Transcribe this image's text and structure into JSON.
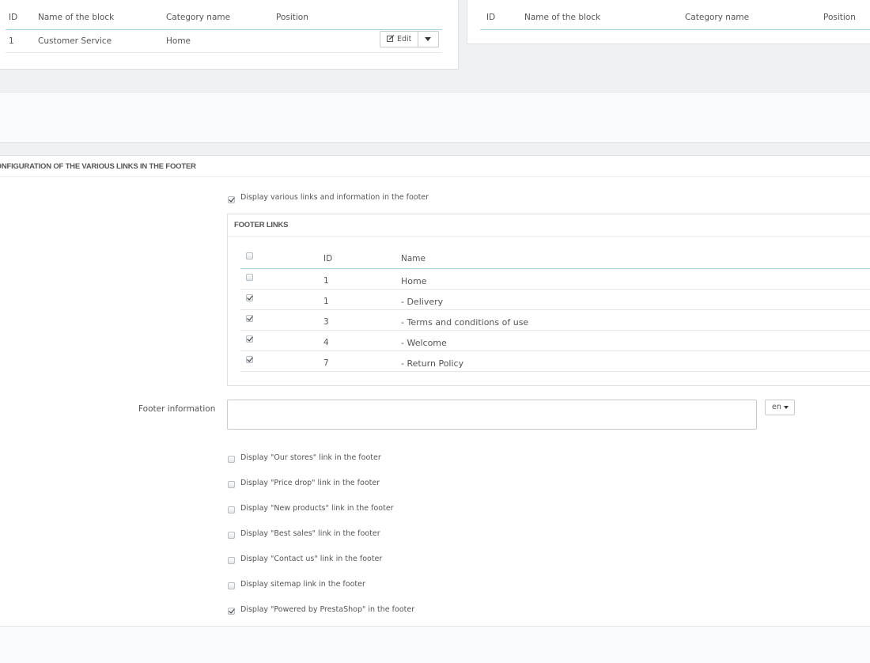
{
  "left_table": {
    "headers": [
      "ID",
      "Name of the block",
      "Category name",
      "Position"
    ],
    "rows": [
      {
        "id": "1",
        "name": "Customer Service",
        "category": "Home",
        "position": ""
      }
    ],
    "edit_label": "Edit"
  },
  "right_table": {
    "headers": [
      "ID",
      "Name of the block",
      "Category name",
      "Position"
    ]
  },
  "config": {
    "title": "CONFIGURATION OF THE VARIOUS LINKS IN THE FOOTER",
    "display_links_label": "Display various links and information in the footer",
    "display_links_checked": true,
    "footer_links": {
      "title": "FOOTER LINKS",
      "headers": {
        "id": "ID",
        "name": "Name"
      },
      "rows": [
        {
          "id": "1",
          "name": "Home",
          "checked": false
        },
        {
          "id": "1",
          "name": "- Delivery",
          "checked": true
        },
        {
          "id": "3",
          "name": "- Terms and conditions of use",
          "checked": true
        },
        {
          "id": "4",
          "name": "- Welcome",
          "checked": true
        },
        {
          "id": "7",
          "name": "- Return Policy",
          "checked": true
        }
      ]
    },
    "footer_information_label": "Footer information",
    "footer_information_value": "",
    "language": "en",
    "options": [
      {
        "label": "Display \"Our stores\" link in the footer",
        "checked": false
      },
      {
        "label": "Display \"Price drop\" link in the footer",
        "checked": false
      },
      {
        "label": "Display \"New products\" link in the footer",
        "checked": false
      },
      {
        "label": "Display \"Best sales\" link in the footer",
        "checked": false
      },
      {
        "label": "Display \"Contact us\" link in the footer",
        "checked": false
      },
      {
        "label": "Display sitemap link in the footer",
        "checked": false
      },
      {
        "label": "Display \"Powered by PrestaShop\" in the footer",
        "checked": true
      }
    ]
  }
}
